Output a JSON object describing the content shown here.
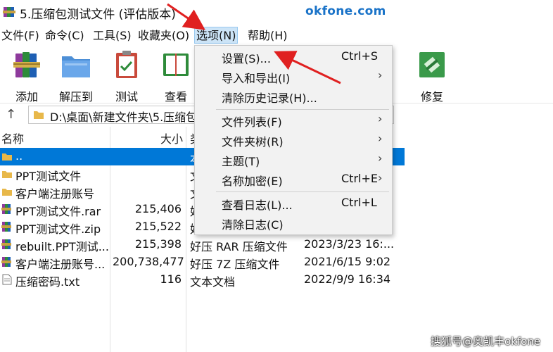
{
  "window": {
    "title": "5.压缩包测试文件 (评估版本)",
    "watermark": "okfone.com",
    "bottom_watermark": "搜狐号@奥凯丰okfone"
  },
  "menubar": [
    {
      "label": "文件(F)"
    },
    {
      "label": "命令(C)"
    },
    {
      "label": "工具(S)"
    },
    {
      "label": "收藏夹(O)"
    },
    {
      "label": "选项(N)"
    },
    {
      "label": "帮助(H)"
    }
  ],
  "toolbar": [
    {
      "label": "添加",
      "icon": "books-archive-icon"
    },
    {
      "label": "解压到",
      "icon": "folder-extract-icon"
    },
    {
      "label": "测试",
      "icon": "clipboard-check-icon"
    },
    {
      "label": "查看",
      "icon": "book-view-icon"
    },
    {
      "label": "修复",
      "icon": "repair-kit-icon"
    }
  ],
  "address": {
    "path": "D:\\桌面\\新建文件夹\\5.压缩包"
  },
  "columns": {
    "name": "名称",
    "size": "大小",
    "type": "类"
  },
  "files": [
    {
      "name": "..",
      "size": "",
      "type": "本",
      "date": "",
      "icon": "parent-folder-icon"
    },
    {
      "name": "PPT测试文件",
      "size": "",
      "type": "文",
      "date": "",
      "icon": "folder-icon"
    },
    {
      "name": "客户端注册账号",
      "size": "",
      "type": "文",
      "date": "",
      "icon": "folder-icon"
    },
    {
      "name": "PPT测试文件.rar",
      "size": "215,406",
      "type": "好",
      "date": "",
      "icon": "rar-icon"
    },
    {
      "name": "PPT测试文件.zip",
      "size": "215,522",
      "type": "好",
      "date": "",
      "icon": "rar-icon"
    },
    {
      "name": "rebuilt.PPT测试...",
      "size": "215,398",
      "type": "好压 RAR 压缩文件",
      "date": "2023/3/23 16:...",
      "icon": "rar-icon"
    },
    {
      "name": "客户端注册账号...",
      "size": "200,738,477",
      "type": "好压 7Z 压缩文件",
      "date": "2021/6/15 9:02",
      "icon": "rar-icon"
    },
    {
      "name": "压缩密码.txt",
      "size": "116",
      "type": "文本文档",
      "date": "2022/9/9 16:34",
      "icon": "text-file-icon"
    }
  ],
  "options_menu": [
    {
      "label": "设置(S)...",
      "shortcut": "Ctrl+S",
      "submenu": false
    },
    {
      "label": "导入和导出(I)",
      "shortcut": "",
      "submenu": true
    },
    {
      "label": "清除历史记录(H)...",
      "shortcut": "",
      "submenu": false
    },
    {
      "label": "文件列表(F)",
      "shortcut": "",
      "submenu": true
    },
    {
      "label": "文件夹树(R)",
      "shortcut": "",
      "submenu": true
    },
    {
      "label": "主题(T)",
      "shortcut": "",
      "submenu": true
    },
    {
      "label": "名称加密(E)",
      "shortcut": "Ctrl+E",
      "submenu": true
    },
    {
      "label": "查看日志(L)...",
      "shortcut": "Ctrl+L",
      "submenu": false
    },
    {
      "label": "清除日志(C)",
      "shortcut": "",
      "submenu": false
    }
  ],
  "colors": {
    "selection": "#0078d7",
    "menu_highlight": "#cce4f7",
    "annotation_arrow": "#e02020",
    "watermark": "#1a73c8"
  }
}
